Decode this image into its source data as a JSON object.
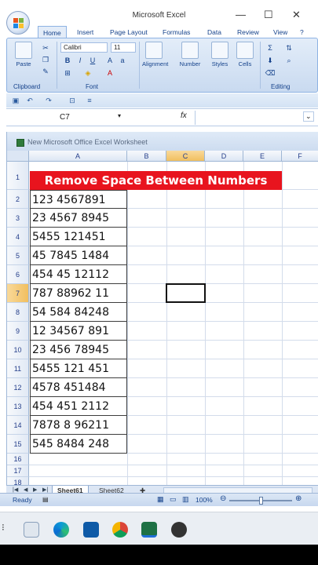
{
  "window": {
    "title": "Microsoft Excel",
    "minimize": "—",
    "maximize": "☐",
    "close": "✕"
  },
  "ribbon": {
    "tabs": [
      "Home",
      "Insert",
      "Page Layout",
      "Formulas",
      "Data",
      "Review",
      "View"
    ],
    "clipboard": {
      "paste": "Paste",
      "label": "Clipboard"
    },
    "font": {
      "name": "Calibri",
      "size": "11",
      "label": "Font"
    },
    "alignment": "Alignment",
    "number": "Number",
    "styles": "Styles",
    "cells": "Cells",
    "editing": "Editing"
  },
  "formula_bar": {
    "name_box": "C7",
    "fx": "fx",
    "value": ""
  },
  "workbook": {
    "title": "New Microsoft Office Excel Worksheet",
    "columns": [
      "A",
      "B",
      "C",
      "D",
      "E",
      "F"
    ],
    "selected_column": "C",
    "rows": [
      "1",
      "2",
      "3",
      "4",
      "5",
      "6",
      "7",
      "8",
      "9",
      "10",
      "11",
      "12",
      "13",
      "14",
      "15",
      "16",
      "17",
      "18"
    ],
    "selected_row": "7",
    "banner": "Remove Space Between Numbers",
    "cells": [
      "123 4567891",
      "23 4567 8945",
      "5455 121451",
      "45 7845 1484",
      "454 45 12112",
      "787 88962 11",
      "54 584 84248",
      "12 34567 891",
      "23 456 78945",
      "5455 121 451",
      "4578 451484",
      "454 451 2112",
      "7878 8 96211",
      "545 8484 248"
    ]
  },
  "sheets": {
    "tabs": [
      "Sheet61",
      "Sheet62"
    ],
    "active": "Sheet61"
  },
  "status": {
    "ready": "Ready",
    "zoom": "100%"
  },
  "colors": {
    "banner": "#e8141e",
    "ribbon": "#c9daf0",
    "selected_header": "#f1bf5f"
  }
}
